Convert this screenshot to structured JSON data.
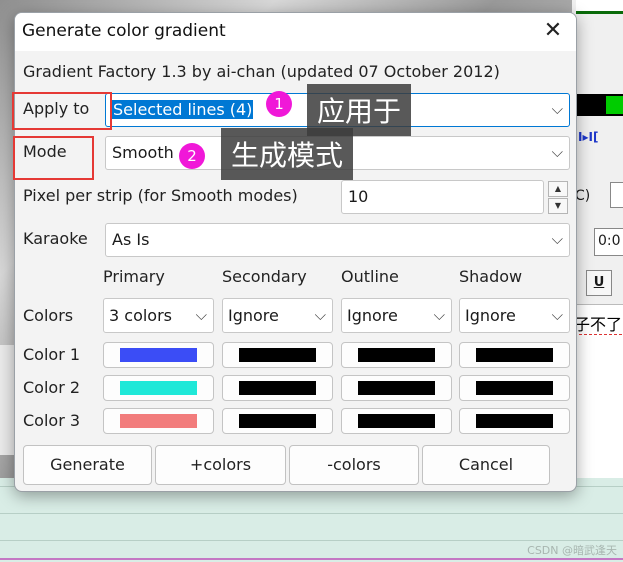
{
  "dialog": {
    "title": "Generate color gradient",
    "close_label": "✕",
    "subtitle": "Gradient Factory 1.3 by ai-chan (updated 07 October 2012)",
    "apply_to": {
      "label": "Apply to",
      "value": "Selected lines (4)"
    },
    "mode": {
      "label": "Mode",
      "value": "Smooth"
    },
    "pixel_per_strip": {
      "label": "Pixel per strip (for Smooth modes)",
      "value": "10"
    },
    "karaoke": {
      "label": "Karaoke",
      "value": "As Is"
    },
    "columns": [
      "Primary",
      "Secondary",
      "Outline",
      "Shadow"
    ],
    "colors_row": {
      "label": "Colors",
      "values": [
        "3 colors",
        "Ignore",
        "Ignore",
        "Ignore"
      ]
    },
    "color_rows": [
      {
        "label": "Color 1",
        "swatches": [
          "#3b4df6",
          "#000000",
          "#000000",
          "#000000"
        ]
      },
      {
        "label": "Color 2",
        "swatches": [
          "#1fe8d8",
          "#000000",
          "#000000",
          "#000000"
        ]
      },
      {
        "label": "Color 3",
        "swatches": [
          "#f27c7c",
          "#000000",
          "#000000",
          "#000000"
        ]
      }
    ],
    "buttons": {
      "generate": "Generate",
      "add_colors": "+colors",
      "remove_colors": "-colors",
      "cancel": "Cancel"
    }
  },
  "annotations": [
    {
      "number": "1",
      "text": "应用于"
    },
    {
      "number": "2",
      "text": "生成模式"
    }
  ],
  "background": {
    "marker_text": "I▸I[",
    "c_text": "C)",
    "time_text": "0:0",
    "underline_btn": "U",
    "subtitle_fragment": "子不了",
    "watermark": "CSDN @暗武逢天"
  }
}
